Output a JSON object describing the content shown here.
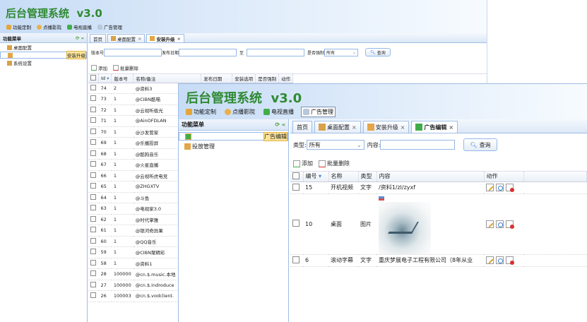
{
  "app_title": "后台管理系统",
  "version": "v3.0",
  "menu": [
    {
      "label": "功能定制",
      "icon": "gift-icon",
      "color": "#e6a53a"
    },
    {
      "label": "点播影院",
      "icon": "film-icon",
      "color": "#e8b04a"
    },
    {
      "label": "电视直播",
      "icon": "tv-icon",
      "color": "#3fae49"
    },
    {
      "label": "广告管理",
      "icon": "megaphone-icon",
      "color": "#7a8fb0"
    }
  ],
  "sidebar_title": "功能菜单",
  "back_window": {
    "sidebar_items": [
      {
        "label": "桌面配置",
        "icon": "wrench-icon"
      },
      {
        "label": "安装升级",
        "icon": "install-icon"
      },
      {
        "label": "系统设置",
        "icon": "wrench-icon"
      }
    ],
    "tabs": [
      "首页",
      "桌面配置",
      "安装升级"
    ],
    "filters": {
      "version_label": "版本号",
      "date_label": "发布日期",
      "to_label": "至",
      "forced_label": "是否强制",
      "forced_value": "所有",
      "search_label": "查询"
    },
    "add_label": "添加",
    "batch_delete_label": "批量删除",
    "columns": [
      "Id",
      "版本号",
      "名称/备注",
      "发布日期",
      "安装选项",
      "是否强制",
      "动作"
    ],
    "rows": [
      [
        "74",
        "2",
        "@资料3"
      ],
      [
        "73",
        "1",
        "@CIBN酷喵"
      ],
      [
        "72",
        "1",
        "@云视听极光"
      ],
      [
        "71",
        "1",
        "@AinOFDLAN"
      ],
      [
        "70",
        "1",
        "@沙发管家"
      ],
      [
        "69",
        "1",
        "@乐播投屏"
      ],
      [
        "68",
        "1",
        "@酷狗音乐"
      ],
      [
        "67",
        "1",
        "@火星直播"
      ],
      [
        "66",
        "1",
        "@云视听虎电竞"
      ],
      [
        "65",
        "1",
        "@ZHGXTV"
      ],
      [
        "64",
        "1",
        "@斗鱼"
      ],
      [
        "63",
        "1",
        "@电视家3.0"
      ],
      [
        "62",
        "1",
        "@时代掌雅"
      ],
      [
        "61",
        "1",
        "@银河奇异果"
      ],
      [
        "60",
        "1",
        "@QQ音乐"
      ],
      [
        "59",
        "1",
        "@CIBN聚精彩"
      ],
      [
        "58",
        "1",
        "@资料1"
      ],
      [
        "28",
        "100000",
        "@cn.$.music.本地"
      ],
      [
        "27",
        "100000",
        "@cn.$.indroduce"
      ],
      [
        "26",
        "100003",
        "@cn.$.vodclient."
      ]
    ]
  },
  "front_window": {
    "sidebar_items": [
      {
        "label": "广告编辑",
        "icon": "ad-edit-icon"
      },
      {
        "label": "投放管理",
        "icon": "install-icon"
      }
    ],
    "tabs": [
      "首页",
      "桌面配置",
      "安装升级",
      "广告编辑"
    ],
    "filters": {
      "type_label": "类型:",
      "type_value": "所有",
      "content_label": "内容:",
      "search_label": "查询"
    },
    "add_label": "添加",
    "batch_delete_label": "批量删除",
    "columns": [
      "编号",
      "名称",
      "类型",
      "内容",
      "动作"
    ],
    "rows": [
      {
        "id": "15",
        "name": "开机视频",
        "type": "文字",
        "content": "/资料1/zl/zyxf"
      },
      {
        "id": "10",
        "name": "桌面",
        "type": "图片",
        "content": ""
      },
      {
        "id": "6",
        "name": "滚动字幕",
        "type": "文字",
        "content": "重庆梦展电子工程有限公司（8年从业"
      }
    ]
  }
}
